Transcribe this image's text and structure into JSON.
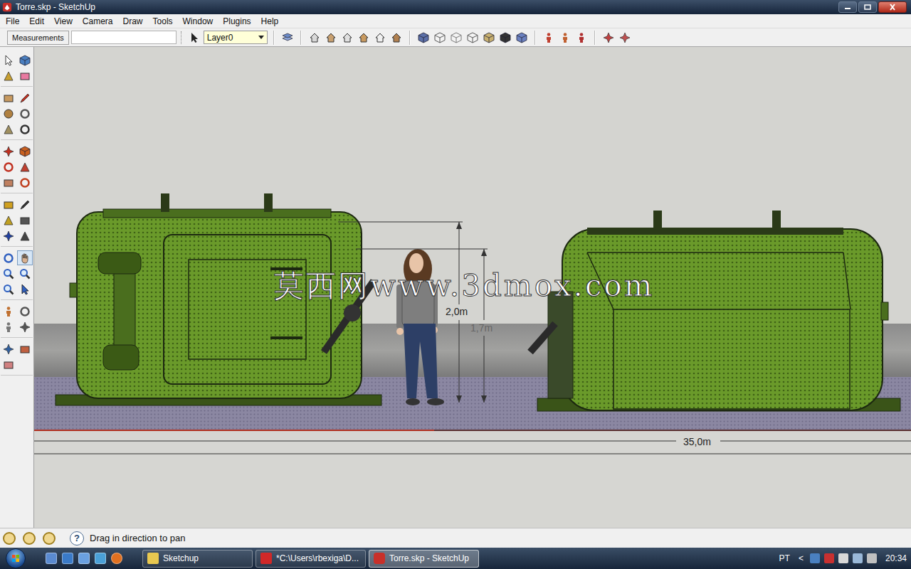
{
  "window": {
    "title": "Torre.skp - SketchUp"
  },
  "menu": [
    "File",
    "Edit",
    "View",
    "Camera",
    "Draw",
    "Tools",
    "Window",
    "Plugins",
    "Help"
  ],
  "measurements": {
    "label": "Measurements",
    "value": ""
  },
  "layer": {
    "value": "Layer0"
  },
  "left_toolbar": {
    "groups": [
      [
        {
          "selected": false
        },
        {
          "selected": false
        },
        {
          "selected": false
        },
        {
          "selected": false
        }
      ],
      [
        {
          "selected": false
        },
        {
          "selected": false
        },
        {
          "selected": false
        },
        {
          "selected": false
        },
        {
          "selected": false
        },
        {
          "selected": false
        }
      ],
      [
        {
          "selected": false
        },
        {
          "selected": false
        },
        {
          "selected": false
        },
        {
          "selected": false
        },
        {
          "selected": false
        },
        {
          "selected": false
        }
      ],
      [
        {
          "selected": false
        },
        {
          "selected": false
        },
        {
          "selected": false
        },
        {
          "selected": false
        },
        {
          "selected": false
        },
        {
          "selected": false
        }
      ],
      [
        {
          "selected": false
        },
        {
          "selected": true
        },
        {
          "selected": false
        },
        {
          "selected": false
        },
        {
          "selected": false
        },
        {
          "selected": false
        }
      ],
      [
        {
          "selected": false
        },
        {
          "selected": false
        },
        {
          "selected": false
        },
        {
          "selected": false
        }
      ],
      [
        {
          "selected": false
        },
        {
          "selected": false
        },
        {
          "selected": false
        }
      ]
    ]
  },
  "viewport": {
    "dimensions": [
      {
        "label": "2,0m"
      },
      {
        "label": "1,7m"
      },
      {
        "label": "35,0m"
      }
    ],
    "watermark": "莫西网www.3dmox.com"
  },
  "status_bar": {
    "help_icon": "?",
    "text": "Drag in direction to pan"
  },
  "taskbar": {
    "tasks": [
      {
        "label": "Sketchup",
        "selected": false
      },
      {
        "label": "*C:\\Users\\rbexiga\\D...",
        "selected": false
      },
      {
        "label": "Torre.skp - SketchUp",
        "selected": true
      }
    ],
    "tray": {
      "language": "PT",
      "chevron": "<",
      "clock": "20:34"
    }
  }
}
